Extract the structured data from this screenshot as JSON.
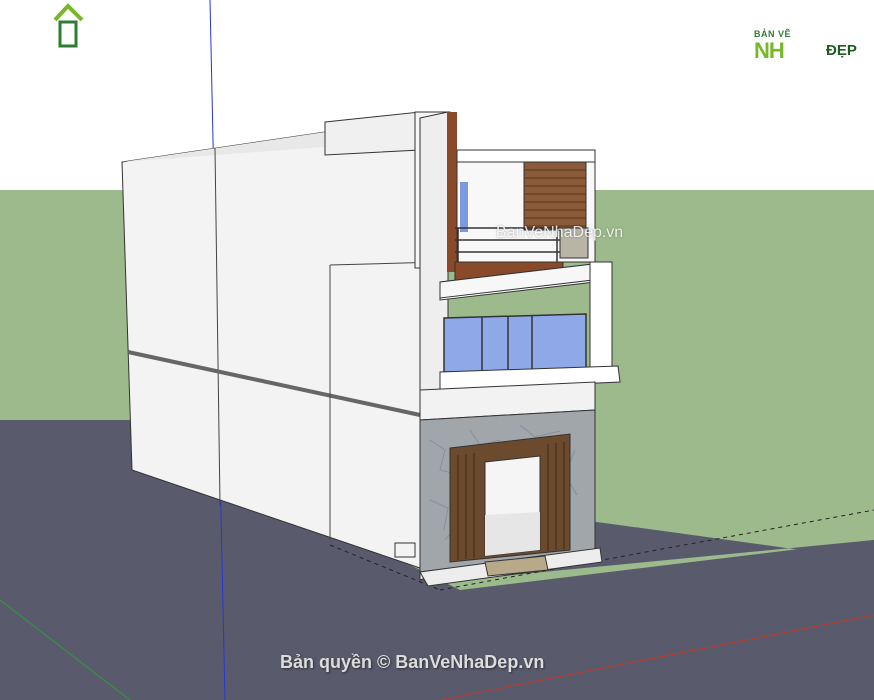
{
  "logo": {
    "small_text": "BẢN VẼ",
    "big_text": "NH",
    "suffix_text": "ĐẸP"
  },
  "watermarks": {
    "center": "BanVeNhaDep.vn",
    "bottom": "Bản quyền © BanVeNhaDep.vn"
  },
  "colors": {
    "sky": "#ffffff",
    "grass": "#9bb98a",
    "road": "#585a6b",
    "wall": "#f4f4f4",
    "glass": "#8fa8e8",
    "brick": "#8a4a2a",
    "stone": "#9ea3a8",
    "wood": "#6b4a2e"
  }
}
